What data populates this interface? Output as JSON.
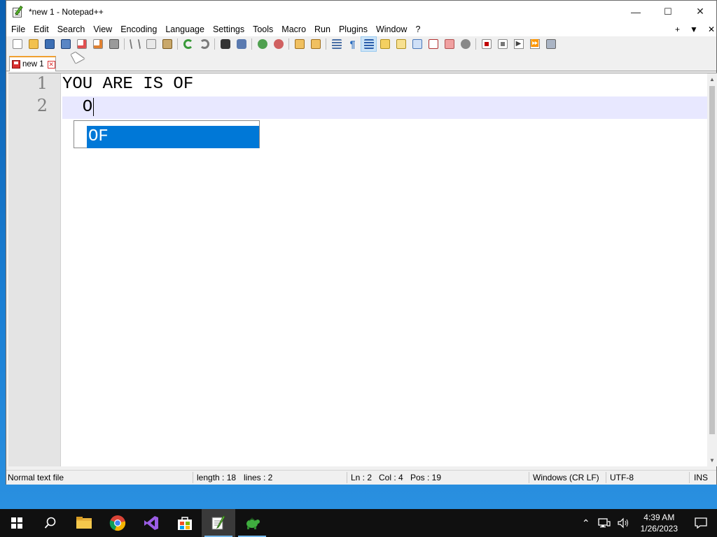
{
  "window": {
    "title": "*new 1 - Notepad++",
    "buttons": {
      "minimize": "—",
      "maximize": "☐",
      "close": "✕"
    }
  },
  "menubar": {
    "items": [
      "File",
      "Edit",
      "Search",
      "View",
      "Encoding",
      "Language",
      "Settings",
      "Tools",
      "Macro",
      "Run",
      "Plugins",
      "Window",
      "?"
    ],
    "right": {
      "add": "+",
      "dropdown": "▼",
      "close": "✕"
    }
  },
  "toolbar": {
    "icons": [
      "new-file-icon",
      "open-file-icon",
      "save-icon",
      "save-all-icon",
      "close-icon",
      "close-all-icon",
      "print-icon",
      "cut-icon",
      "copy-icon",
      "paste-icon",
      "undo-icon",
      "redo-icon",
      "find-icon",
      "replace-icon",
      "zoom-in-icon",
      "zoom-out-icon",
      "sync-vertical-icon",
      "sync-horizontal-icon",
      "word-wrap-icon",
      "show-all-chars-icon",
      "indent-guide-icon",
      "udl-icon",
      "doc-map-icon",
      "function-list-icon",
      "folder-workspace-icon",
      "monitoring-icon",
      "record-macro-icon",
      "stop-record-icon",
      "play-macro-icon",
      "run-macro-multiple-icon",
      "save-macro-icon"
    ]
  },
  "tabs": [
    {
      "label": "new 1"
    }
  ],
  "editor": {
    "line_numbers": [
      "1",
      "2"
    ],
    "lines": [
      "YOU ARE IS OF",
      "  O"
    ]
  },
  "autocomplete": {
    "items": [
      "OF"
    ],
    "selected": "OF"
  },
  "statusbar": {
    "file_type": "Normal text file",
    "length": "length : 18",
    "lines": "lines : 2",
    "ln": "Ln : 2",
    "col": "Col : 4",
    "pos": "Pos : 19",
    "eol": "Windows (CR LF)",
    "encoding": "UTF-8",
    "mode": "INS"
  },
  "taskbar": {
    "apps": [
      "start-icon",
      "search-icon",
      "file-explorer-icon",
      "chrome-icon",
      "visual-studio-icon",
      "store-icon",
      "notepadpp-icon",
      "tortoise-icon"
    ],
    "clock_time": "4:39 AM",
    "clock_date": "1/26/2023"
  },
  "colors": {
    "accent": "#0078d7",
    "current_line": "#e8e8ff",
    "gutter": "#e4e4e4"
  }
}
